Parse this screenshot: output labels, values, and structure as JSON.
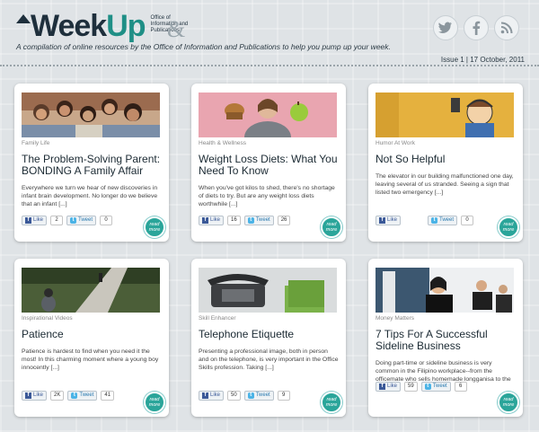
{
  "header": {
    "logo_week": "Week",
    "logo_up": "Up",
    "office_line": "Office of Information and Publications",
    "amp": "&",
    "tagline": "A compilation of online resources by the Office of Information and Publications to help you pump up your week.",
    "issue": "Issue 1 | 17 October, 2011",
    "social_icons": [
      "twitter-icon",
      "facebook-icon",
      "rss-icon"
    ]
  },
  "colors": {
    "brand_dark": "#1e2f3c",
    "brand_teal": "#1f8f86",
    "readmore": "#2aa59a"
  },
  "cards": [
    {
      "category": "Family Life",
      "title": "The Problem-Solving Parent: BONDING  A Family Affair",
      "excerpt": "Everywhere we turn we hear of new discoveries in infant brain development. No longer do we believe that an infant [...]",
      "like_label": "Like",
      "like_count": "2",
      "tweet_label": "Tweet",
      "tweet_count": "0",
      "readmore": "read more"
    },
    {
      "category": "Health & Wellness",
      "title": "Weight Loss Diets: What You Need To Know",
      "excerpt": "When you've got kilos to shed, there's no shortage of diets to try. But are any weight loss diets worthwhile [...]",
      "like_label": "Like",
      "like_count": "16",
      "tweet_label": "Tweet",
      "tweet_count": "26",
      "readmore": "read more"
    },
    {
      "category": "Humor At Work",
      "title": "Not So Helpful",
      "excerpt": "The elevator in our building malfunctioned one day, leaving several of us stranded. Seeing a sign that listed two emergency [...]",
      "like_label": "Like",
      "like_count": "",
      "tweet_label": "Tweet",
      "tweet_count": "0",
      "readmore": "read more"
    },
    {
      "category": "Inspirational Videos",
      "title": "Patience",
      "excerpt": "Patience is hardest to find when you need it the most! In this charming moment where a young boy innocently [...]",
      "like_label": "Like",
      "like_count": "2K",
      "tweet_label": "Tweet",
      "tweet_count": "41",
      "readmore": "read more"
    },
    {
      "category": "Skill Enhancer",
      "title": "Telephone Etiquette",
      "excerpt": "Presenting a professional image, both in person and on the telephone, is very important in the Office Skills profession. Taking [...]",
      "like_label": "Like",
      "like_count": "50",
      "tweet_label": "Tweet",
      "tweet_count": "9",
      "readmore": "read more"
    },
    {
      "category": "Money Matters",
      "title": "7 Tips For A Successful Sideline Business",
      "excerpt": "Doing part-time or sideline business is very common in the Filipino workplace--from the officemate who sells homemade longganisa to the [...]",
      "like_label": "Like",
      "like_count": "59",
      "tweet_label": "Tweet",
      "tweet_count": "6",
      "readmore": "read more"
    }
  ]
}
